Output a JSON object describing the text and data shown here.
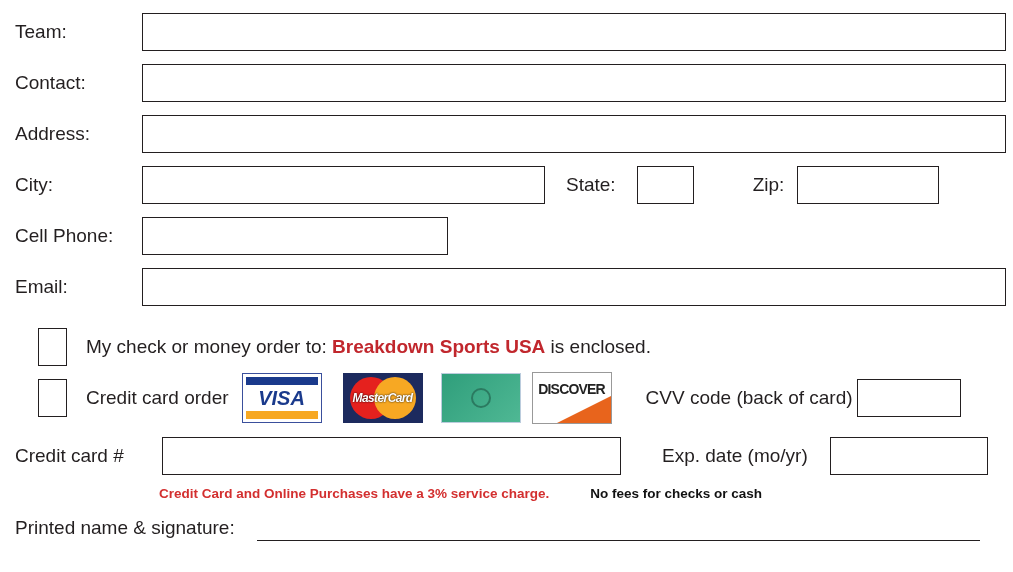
{
  "fields": [
    {
      "label": "Team:",
      "kind": "wide"
    },
    {
      "label": "Contact:",
      "kind": "wide"
    },
    {
      "label": "Address:",
      "kind": "wide"
    },
    {
      "label": "City:",
      "kind": "city"
    },
    {
      "label": "Cell Phone:",
      "kind": "phone"
    },
    {
      "label": "Email:",
      "kind": "wide"
    }
  ],
  "city_extras": [
    {
      "label": "State:",
      "kind": "state"
    },
    {
      "label": "Zip:",
      "kind": "zip"
    }
  ],
  "payment_options": [
    {
      "label": "My check or money order to: **Breakdown Sports USA** is enclosed.",
      "checked": false
    },
    {
      "label": "Credit card order",
      "checked": false
    }
  ],
  "card_logos": [
    {
      "kind": "visa",
      "text": "VISA"
    },
    {
      "kind": "mastercard",
      "text": "MasterCard"
    },
    {
      "kind": "amex"
    },
    {
      "kind": "discover",
      "text": "DISCOVER"
    }
  ],
  "cvv": {
    "label": "CVV code (back of card)"
  },
  "card_number": {
    "label": "Credit card #"
  },
  "expiry": {
    "label": "Exp. date (mo/yr)"
  },
  "service_note": "Credit Card and Online Purchases have a 3% service charge.",
  "fees_note": "No fees for checks or cash",
  "signature": {
    "label": "Printed name & signature:"
  }
}
